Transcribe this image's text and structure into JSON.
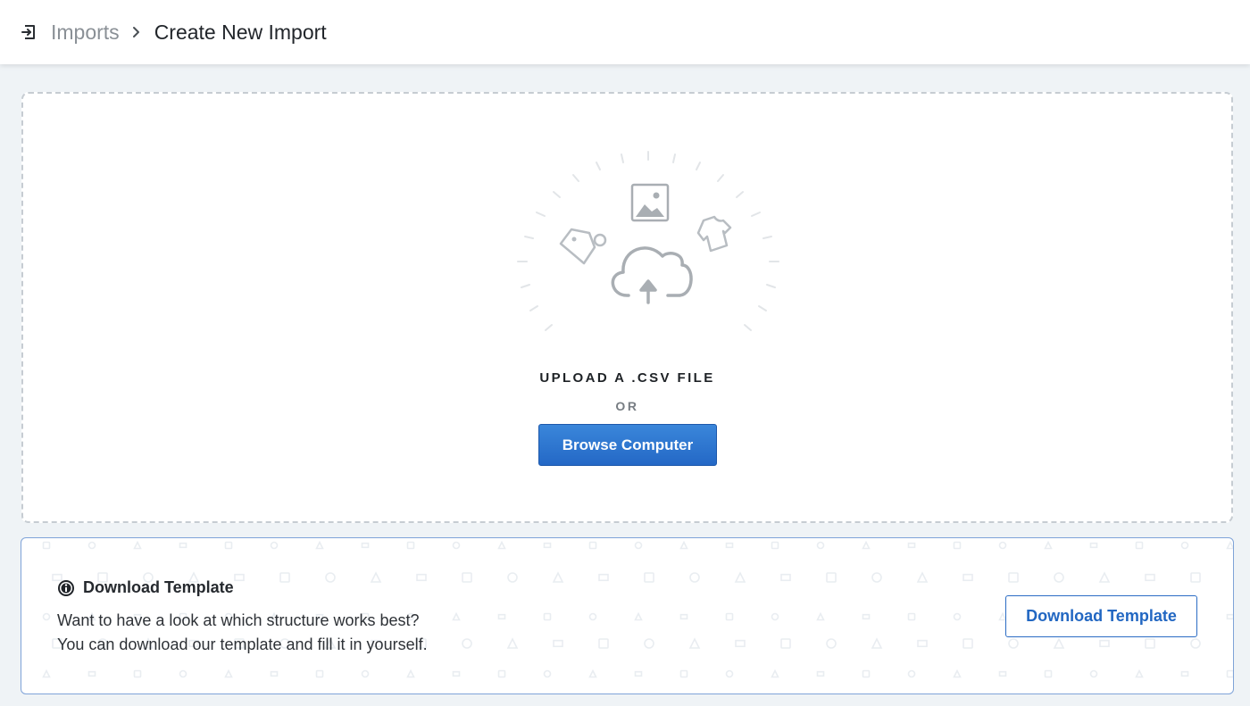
{
  "header": {
    "icon": "import-icon",
    "breadcrumb": {
      "parent": "Imports",
      "separator_icon": "chevron-right-icon",
      "current": "Create New Import"
    }
  },
  "upload": {
    "illustration_icons": [
      "cloud-upload-icon",
      "image-icon",
      "tag-icon",
      "shirt-icon"
    ],
    "label": "UPLOAD A .CSV FILE",
    "or": "OR",
    "browse_button": "Browse Computer",
    "accent_color": "#2f78d2"
  },
  "template": {
    "icon": "info-icon",
    "title": "Download Template",
    "line1": "Want to have a look at which structure works best?",
    "line2": "You can download our template and fill it in yourself.",
    "button": "Download Template",
    "border_color": "#7fa3d8"
  }
}
